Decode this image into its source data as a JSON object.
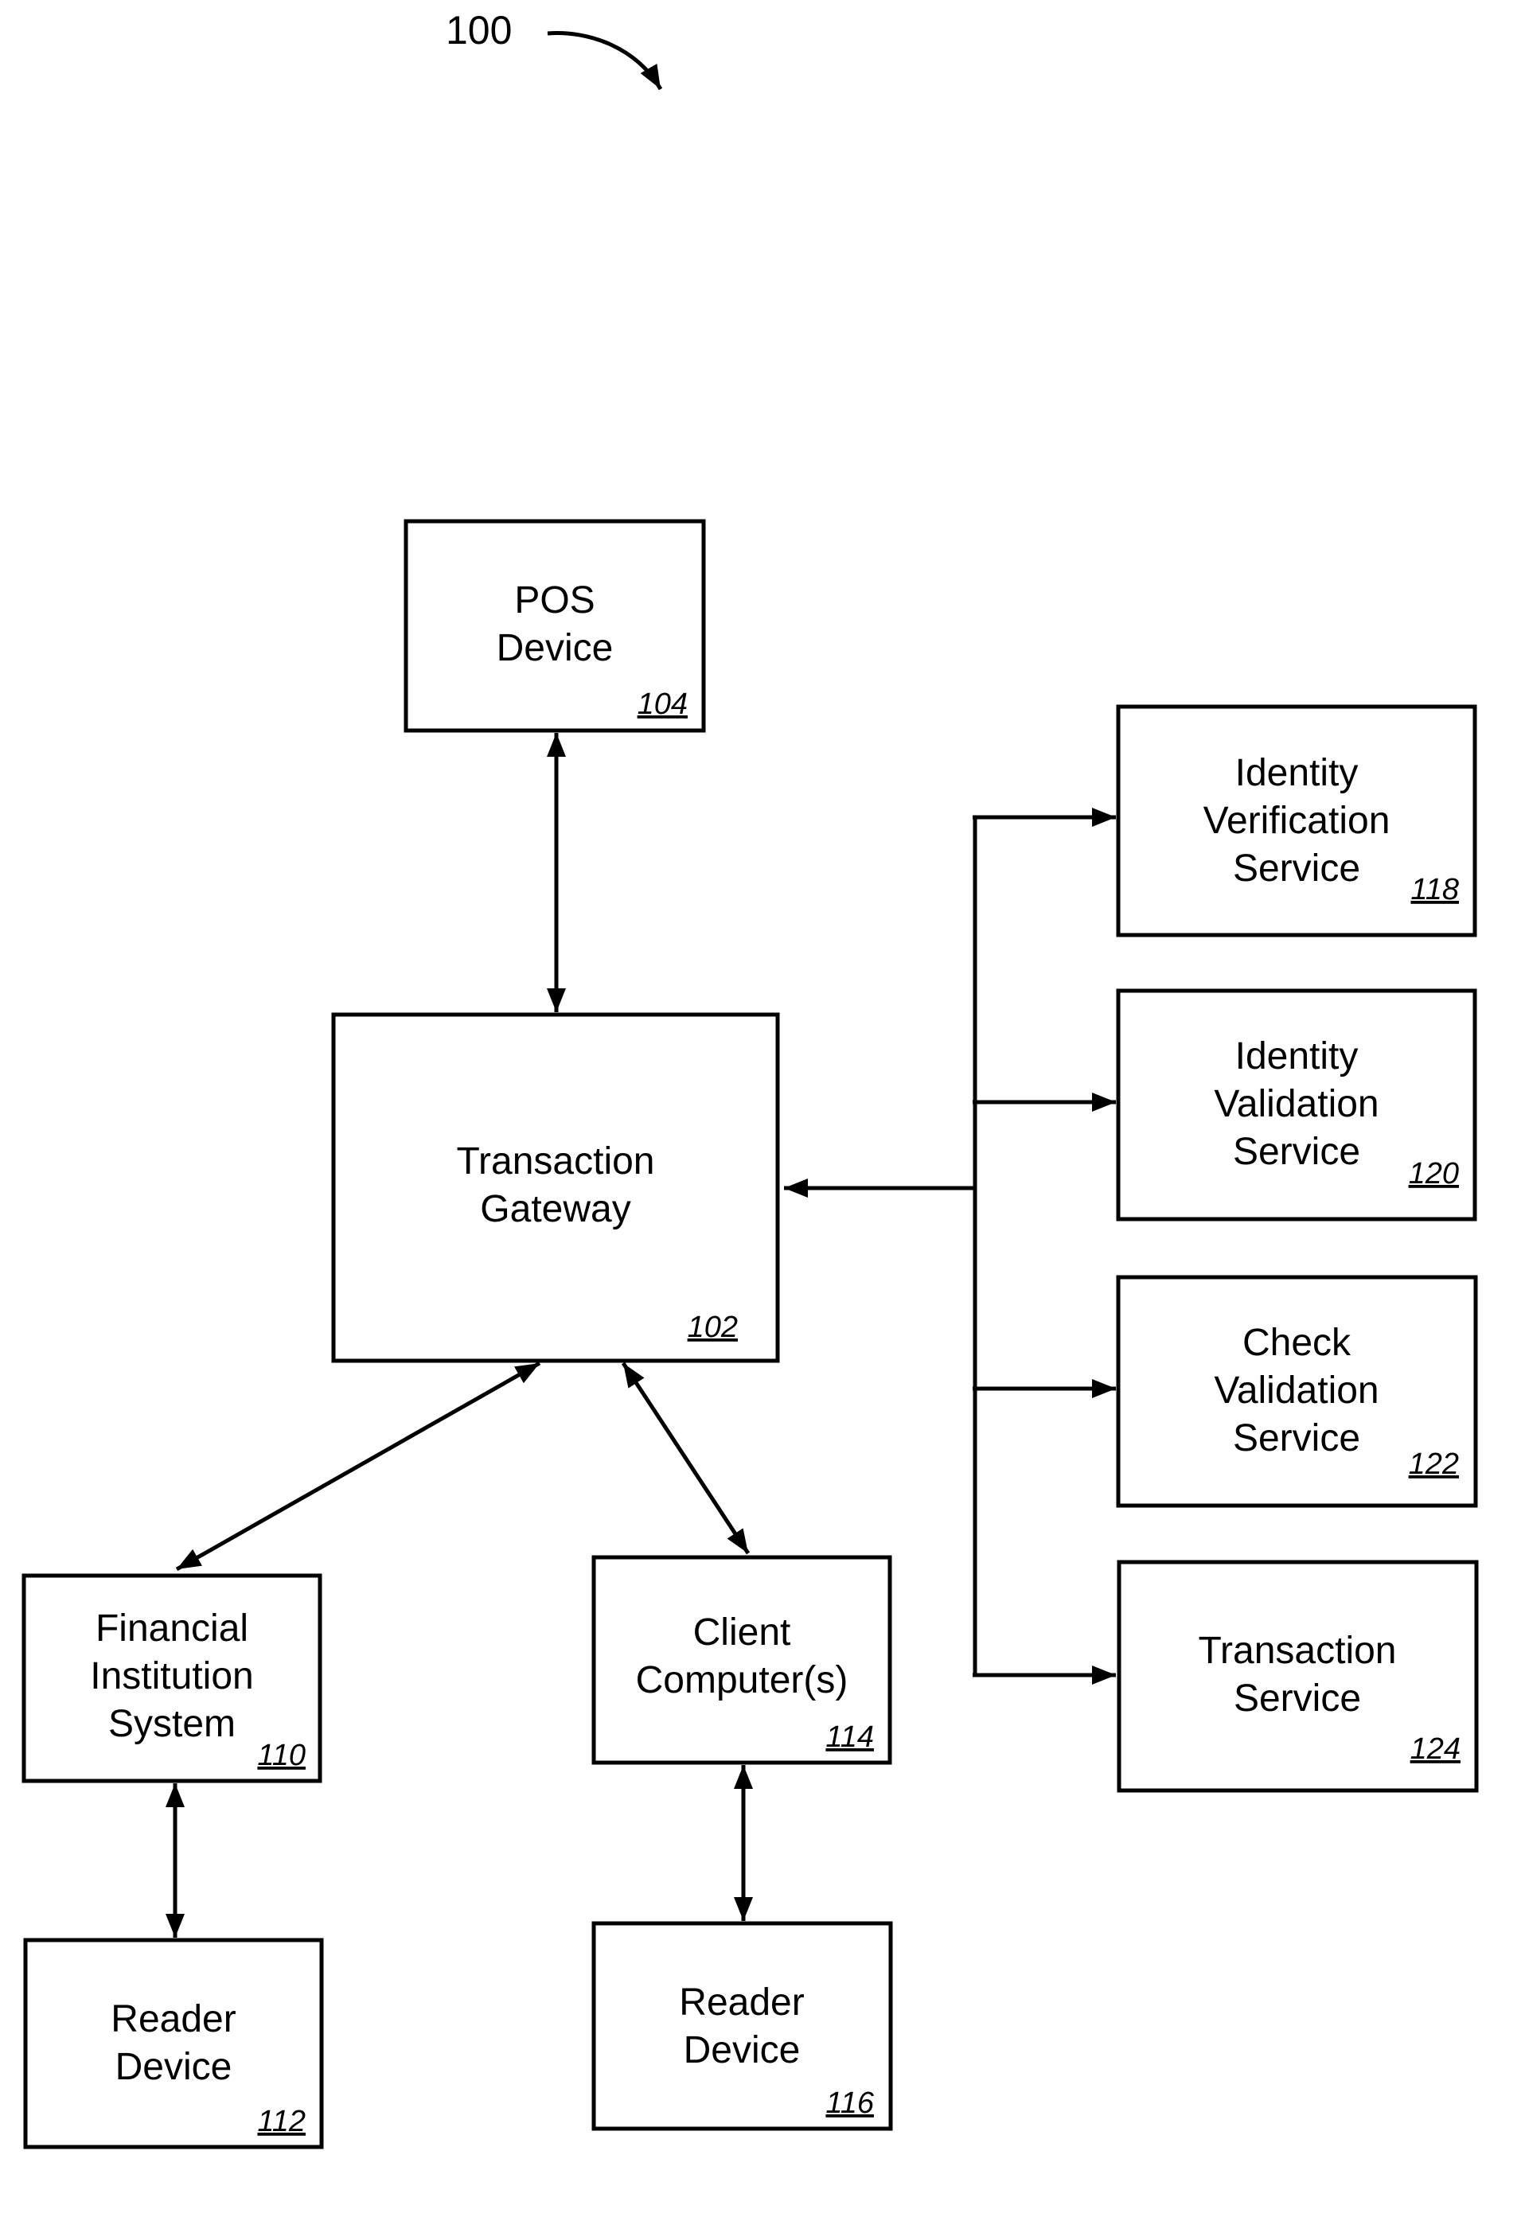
{
  "figure": {
    "label": "100"
  },
  "boxes": [
    {
      "id": "pos",
      "lines": [
        "POS",
        "Device"
      ],
      "ref": "104"
    },
    {
      "id": "gateway",
      "lines": [
        "Transaction",
        "Gateway"
      ],
      "ref": "102"
    },
    {
      "id": "fis",
      "lines": [
        "Financial",
        "Institution",
        "System"
      ],
      "ref": "110"
    },
    {
      "id": "reader1",
      "lines": [
        "Reader",
        "Device"
      ],
      "ref": "112"
    },
    {
      "id": "client",
      "lines": [
        "Client",
        "Computer(s)"
      ],
      "ref": "114"
    },
    {
      "id": "reader2",
      "lines": [
        "Reader",
        "Device"
      ],
      "ref": "116"
    },
    {
      "id": "idver",
      "lines": [
        "Identity",
        "Verification",
        "Service"
      ],
      "ref": "118"
    },
    {
      "id": "idval",
      "lines": [
        "Identity",
        "Validation",
        "Service"
      ],
      "ref": "120"
    },
    {
      "id": "check",
      "lines": [
        "Check",
        "Validation",
        "Service"
      ],
      "ref": "122"
    },
    {
      "id": "txsvc",
      "lines": [
        "Transaction",
        "Service"
      ],
      "ref": "124"
    }
  ]
}
